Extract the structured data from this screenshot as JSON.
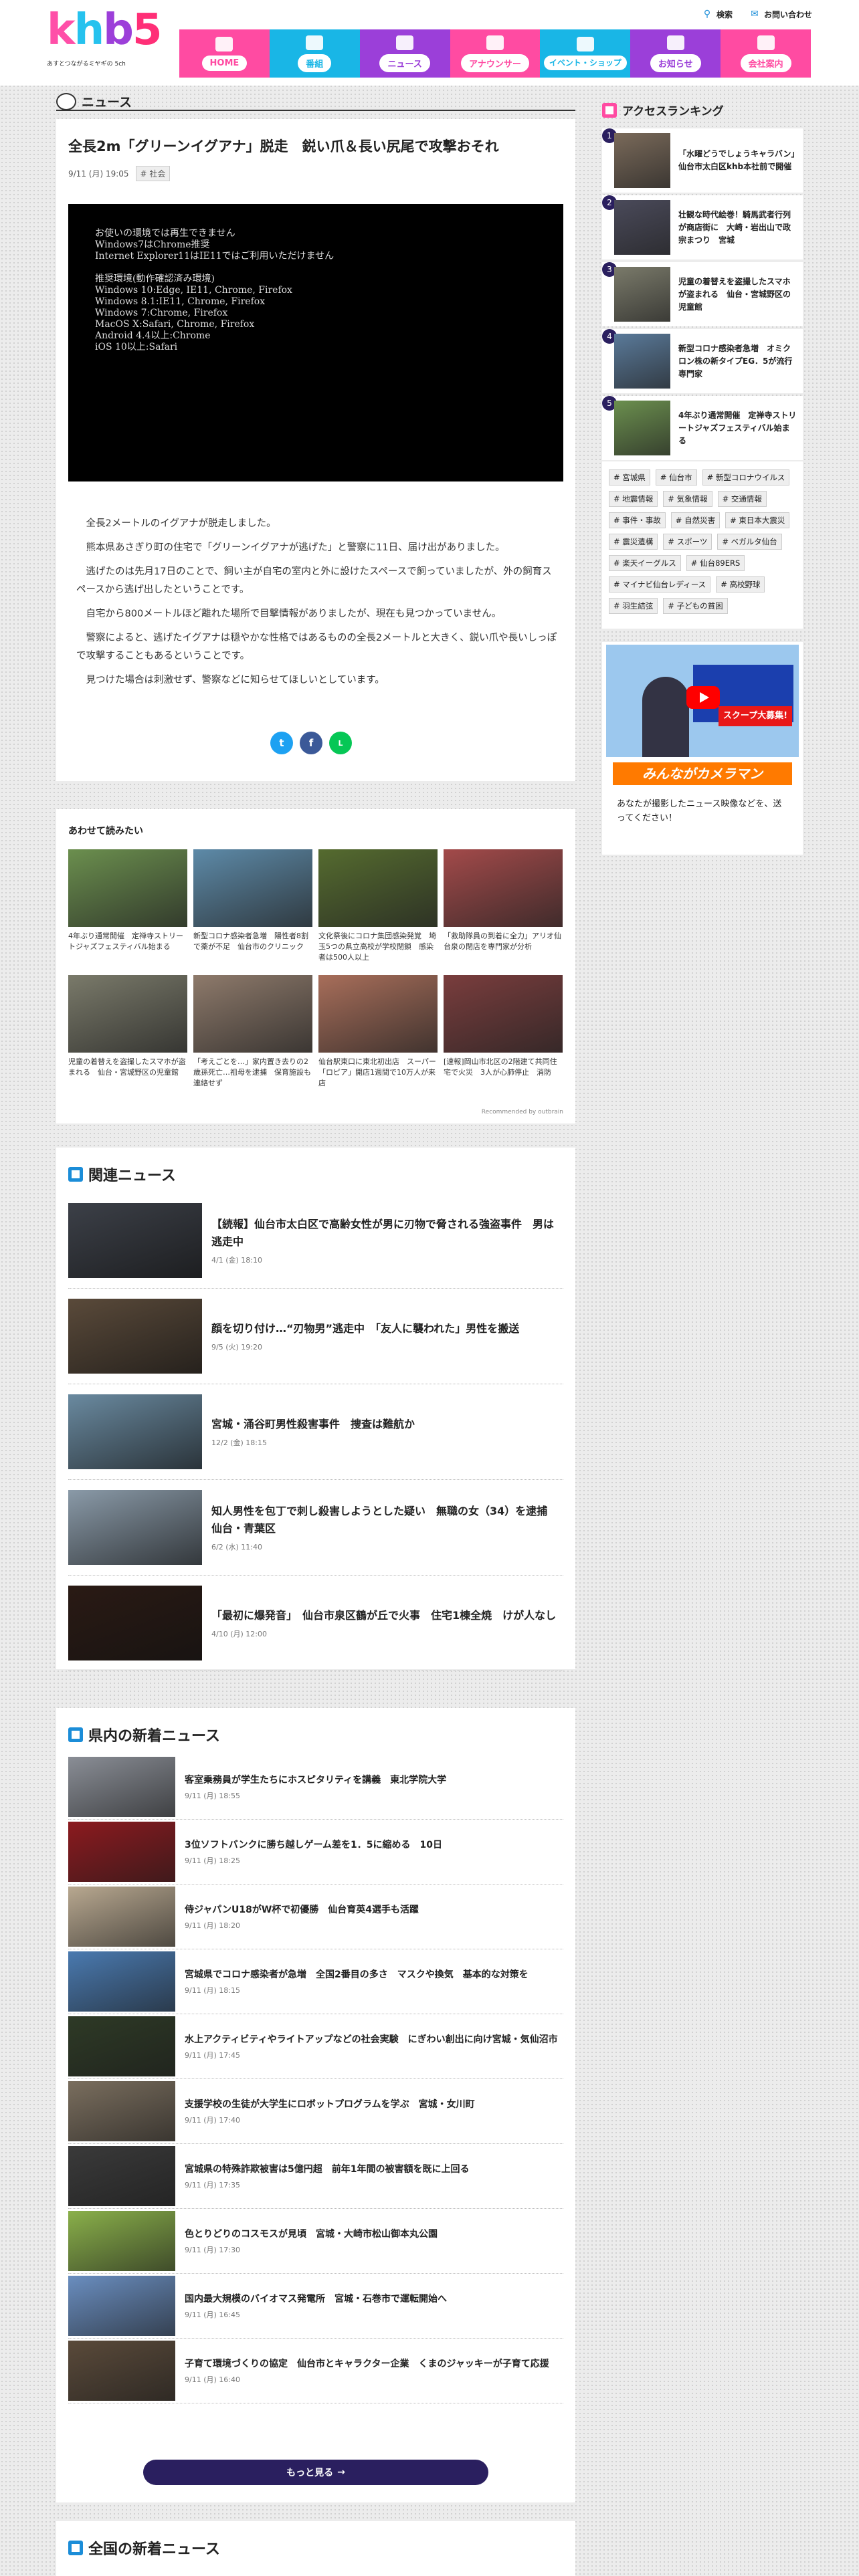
{
  "brand": {
    "logo_text": "khb5",
    "tagline": "あすとつながるミヤギの 5ch"
  },
  "util": {
    "search": "検索",
    "contact": "お問い合わせ"
  },
  "nav": [
    {
      "label": "HOME",
      "icon": "home-icon"
    },
    {
      "label": "番組",
      "icon": "tv-icon"
    },
    {
      "label": "ニュース",
      "icon": "news-icon"
    },
    {
      "label": "アナウンサー",
      "icon": "announcer-icon"
    },
    {
      "label": "イベント・ショップ",
      "icon": "shop-icon"
    },
    {
      "label": "お知らせ",
      "icon": "notice-icon"
    },
    {
      "label": "会社案内",
      "icon": "building-icon"
    }
  ],
  "section_title": "ニュース",
  "article": {
    "title": "全長2m「グリーンイグアナ」脱走　鋭い爪＆長い尻尾で攻撃おそれ",
    "date": "9/11 (月) 19:05",
    "tag": "# 社会",
    "video_msg": [
      "お使いの環境では再生できません",
      "Windows7はChrome推奨",
      "Internet Explorer11はIE11ではご利用いただけません",
      "",
      "推奨環境(動作確認済み環境)",
      "Windows 10:Edge, IE11, Chrome, Firefox",
      "Windows 8.1:IE11, Chrome, Firefox",
      "Windows 7:Chrome, Firefox",
      "MacOS X:Safari, Chrome, Firefox",
      "Android 4.4以上:Chrome",
      "iOS 10以上:Safari"
    ],
    "paragraphs": [
      "全長2メートルのイグアナが脱走しました。",
      "熊本県あさぎり町の住宅で「グリーンイグアナが逃げた」と警察に11日、届け出がありました。",
      "逃げたのは先月17日のことで、飼い主が自宅の室内と外に設けたスペースで飼っていましたが、外の飼育スペースから逃げ出したということです。",
      "自宅から800メートルほど離れた場所で目撃情報がありましたが、現在も見つかっていません。",
      "警察によると、逃げたイグアナは穏やかな性格ではあるものの全長2メートルと大きく、鋭い爪や長いしっぽで攻撃することもあるということです。",
      "見つけた場合は刺激せず、警察などに知らせてほしいとしています。"
    ],
    "share": {
      "twitter": "t",
      "facebook": "f",
      "line": "L"
    }
  },
  "recommend": {
    "title": "あわせて読みたい",
    "items": [
      {
        "caption": "4年ぶり通常開催　定禅寺ストリートジャズフェスティバル始まる",
        "color": "#6b8f4e"
      },
      {
        "caption": "新型コロナ感染者急増　陽性者8割で薬が不足　仙台市のクリニック",
        "color": "#5d8aa8"
      },
      {
        "caption": "文化祭後にコロナ集団感染発覚　埼玉5つの県立高校が学校閉鎖　感染者は500人以上",
        "color": "#556b2f"
      },
      {
        "caption": "「救助隊員の到着に全力」アリオ仙台泉の閉店を専門家が分析",
        "color": "#a34a4a"
      },
      {
        "caption": "児童の着替えを盗撮したスマホが盗まれる　仙台・宮城野区の児童館",
        "color": "#7a7a6a"
      },
      {
        "caption": "「考えごとを…」家内置き去りの2歳孫死亡…祖母を逮捕　保育施設も連絡せず",
        "color": "#8e7a6b"
      },
      {
        "caption": "仙台駅東口に東北初出店　スーパー「ロピア」開店1週間で10万人が来店",
        "color": "#a86e5a"
      },
      {
        "caption": "[速報]岡山市北区の2階建て共同住宅で火災　3人が心肺停止　消防",
        "color": "#7a3d3d"
      }
    ],
    "powered": "Recommended by outbrain"
  },
  "related": {
    "title": "関連ニュース",
    "items": [
      {
        "title": "【続報】仙台市太白区で高齢女性が男に刃物で脅される強盗事件　男は逃走中",
        "date": "4/1 (金) 18:10",
        "color": "#3c4048"
      },
      {
        "title": "顔を切り付け…“刃物男”逃走中　「友人に襲われた」男性を搬送",
        "date": "9/5 (火) 19:20",
        "color": "#5a4a3a"
      },
      {
        "title": "宮城・涌谷町男性殺害事件　捜査は難航か",
        "date": "12/2 (金) 18:15",
        "color": "#6a8aa0"
      },
      {
        "title": "知人男性を包丁で刺し殺害しようとした疑い　無職の女（34）を逮捕　仙台・青葉区",
        "date": "6/2 (水) 11:40",
        "color": "#8a9aa8"
      },
      {
        "title": "「最初に爆発音」　仙台市泉区鶴が丘で火事　住宅1棟全焼　けが人なし",
        "date": "4/10 (月) 12:00",
        "color": "#2a1a14"
      }
    ]
  },
  "local": {
    "title": "県内の新着ニュース",
    "items": [
      {
        "title": "客室乗務員が学生たちにホスピタリティを講義　東北学院大学",
        "date": "9/11 (月) 18:55",
        "color": "#8a8e96"
      },
      {
        "title": "3位ソフトバンクに勝ち越しゲーム差を1．5に縮める　10日",
        "date": "9/11 (月) 18:25",
        "color": "#8c1a1f"
      },
      {
        "title": "侍ジャパンU18がW杯で初優勝　仙台育英4選手も活躍",
        "date": "9/11 (月) 18:20",
        "color": "#b8a890"
      },
      {
        "title": "宮城県でコロナ感染者が急増　全国2番目の多さ　マスクや換気　基本的な対策を",
        "date": "9/11 (月) 18:15",
        "color": "#4a7ab0"
      },
      {
        "title": "水上アクティビティやライトアップなどの社会実験　にぎわい創出に向け宮城・気仙沼市",
        "date": "9/11 (月) 17:45",
        "color": "#2e3a26"
      },
      {
        "title": "支援学校の生徒が大学生にロボットプログラムを学ぶ　宮城・女川町",
        "date": "9/11 (月) 17:40",
        "color": "#7a6e5e"
      },
      {
        "title": "宮城県の特殊詐欺被害は5億円超　前年1年間の被害額を既に上回る",
        "date": "9/11 (月) 17:35",
        "color": "#3a3a3a"
      },
      {
        "title": "色とりどりのコスモスが見頃　宮城・大崎市松山御本丸公園",
        "date": "9/11 (月) 17:30",
        "color": "#8ab04a"
      },
      {
        "title": "国内最大規模のバイオマス発電所　宮城・石巻市で運転開始へ",
        "date": "9/11 (月) 16:45",
        "color": "#6a8ec0"
      },
      {
        "title": "子育て環境づくりの協定　仙台市とキャラクター企業　くまのジャッキーが子育て応援",
        "date": "9/11 (月) 16:40",
        "color": "#5a4a3a"
      }
    ],
    "more": "もっと見る"
  },
  "nation": {
    "title": "全国の新着ニュース"
  },
  "ranking": {
    "title": "アクセスランキング",
    "items": [
      {
        "rank": "1",
        "title": "「水曜どうでしょうキャラバン」仙台市太白区khb本社前で開催",
        "color": "#7a6a5a"
      },
      {
        "rank": "2",
        "title": "壮観な時代絵巻！騎馬武者行列が商店街に　大崎・岩出山で政宗まつり　宮城",
        "color": "#4a4a5a"
      },
      {
        "rank": "3",
        "title": "児童の着替えを盗撮したスマホが盗まれる　仙台・宮城野区の児童館",
        "color": "#7a7a6a"
      },
      {
        "rank": "4",
        "title": "新型コロナ感染者急増　オミクロン株の新タイプEG．5が流行　専門家",
        "color": "#5a7a9a"
      },
      {
        "rank": "5",
        "title": "4年ぶり通常開催　定禅寺ストリートジャズフェスティバル始まる",
        "color": "#6b8f4e"
      }
    ]
  },
  "tags": [
    "# 宮城県",
    "# 仙台市",
    "# 新型コロナウイルス",
    "# 地震情報",
    "# 気象情報",
    "# 交通情報",
    "# 事件・事故",
    "# 自然災害",
    "# 東日本大震災",
    "# 震災遺構",
    "# スポーツ",
    "# ベガルタ仙台",
    "# 楽天イーグルス",
    "# 仙台89ERS",
    "# マイナビ仙台レディース",
    "# 高校野球",
    "# 羽生結弦",
    "# 子どもの貧困"
  ],
  "youtube": {
    "banner": "みんながカメラマン",
    "bnr_text": "スクープ大募集!",
    "caption": "あなたが撮影したニュース映像などを、送ってください！"
  }
}
